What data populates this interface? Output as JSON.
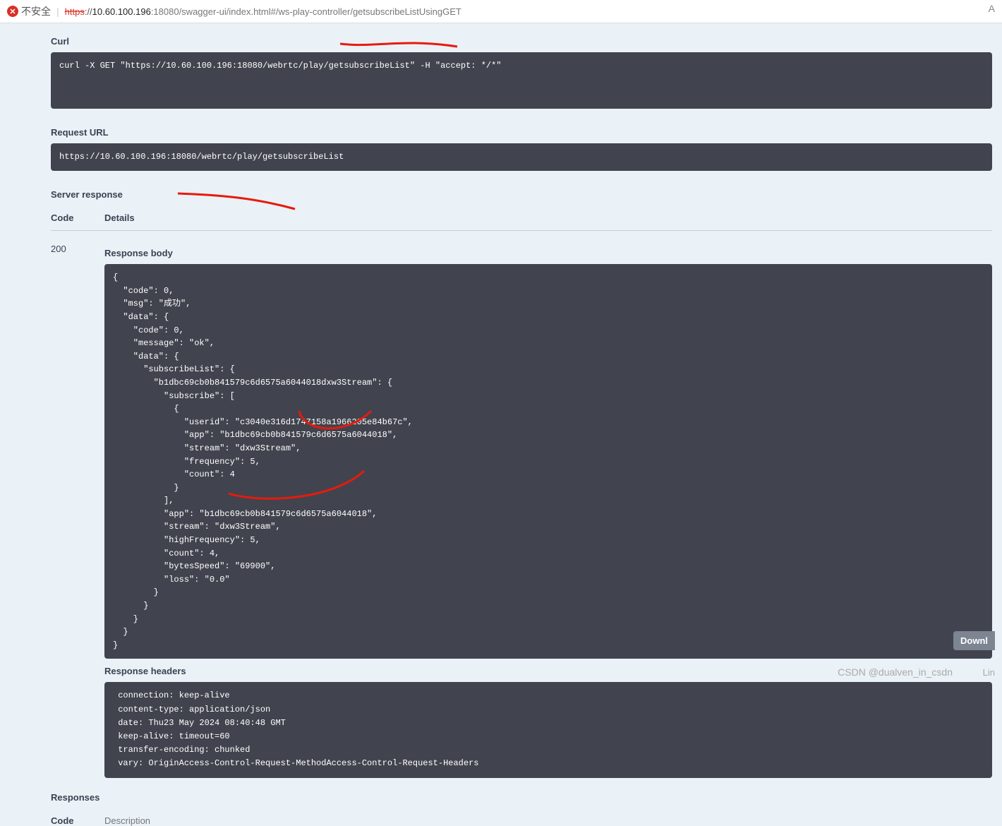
{
  "browser": {
    "security_label": "不安全",
    "url_https": "https",
    "url_sep": "://",
    "url_host": "10.60.100.196",
    "url_port_path": ":18080/swagger-ui/index.html#/ws-play-controller/getsubscribeListUsingGET",
    "avatar": "A"
  },
  "curl": {
    "title": "Curl",
    "command": "curl -X GET \"https://10.60.100.196:18080/webrtc/play/getsubscribeList\" -H \"accept: */*\""
  },
  "request_url": {
    "title": "Request URL",
    "value": "https://10.60.100.196:18080/webrtc/play/getsubscribeList"
  },
  "server_response": {
    "title": "Server response",
    "code_header": "Code",
    "details_header": "Details",
    "code": "200",
    "body_title": "Response body",
    "body": "{\n  \"code\": 0,\n  \"msg\": \"成功\",\n  \"data\": {\n    \"code\": 0,\n    \"message\": \"ok\",\n    \"data\": {\n      \"subscribeList\": {\n        \"b1dbc69cb0b841579c6d6575a6044018dxw3Stream\": {\n          \"subscribe\": [\n            {\n              \"userid\": \"c3040e316d1747158a1966205e84b67c\",\n              \"app\": \"b1dbc69cb0b841579c6d6575a6044018\",\n              \"stream\": \"dxw3Stream\",\n              \"frequency\": 5,\n              \"count\": 4\n            }\n          ],\n          \"app\": \"b1dbc69cb0b841579c6d6575a6044018\",\n          \"stream\": \"dxw3Stream\",\n          \"highFrequency\": 5,\n          \"count\": 4,\n          \"bytesSpeed\": \"69900\",\n          \"loss\": \"0.0\"\n        }\n      }\n    }\n  }\n}",
    "download_label": "Downl",
    "headers_title": "Response headers",
    "headers": " connection: keep-alive \n content-type: application/json \n date: Thu23 May 2024 08:40:48 GMT \n keep-alive: timeout=60 \n transfer-encoding: chunked \n vary: OriginAccess-Control-Request-MethodAccess-Control-Request-Headers "
  },
  "responses": {
    "title": "Responses",
    "code_header": "Code",
    "description_header": "Description"
  },
  "watermark": "CSDN @dualven_in_csdn",
  "watermark2": "Lin"
}
